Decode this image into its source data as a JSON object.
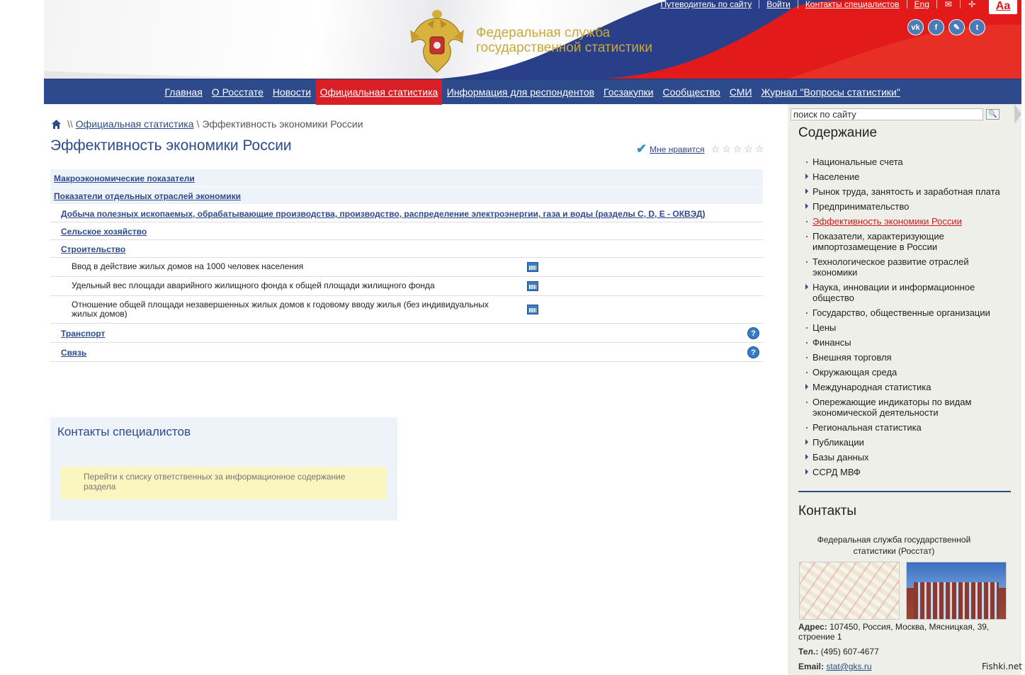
{
  "header": {
    "title_line1": "Федеральная служба",
    "title_line2": "государственной статистики",
    "toplinks": [
      "Путеводитель по сайту",
      "Войти",
      "Контакты специалистов",
      "Eng"
    ],
    "font_size_label": "Aa",
    "social": [
      "vk",
      "f",
      "✎",
      "t"
    ]
  },
  "nav": [
    "Главная",
    "О Росстате",
    "Новости",
    "Официальная статистика",
    "Информация для респондентов",
    "Госзакупки",
    "Сообщество",
    "СМИ",
    "Журнал \"Вопросы статистики\""
  ],
  "breadcrumb": {
    "sep1": "\\\\",
    "link": "Официальная статистика",
    "sep2": "\\",
    "current": "Эффективность экономики России"
  },
  "page_title": "Эффективность экономики России",
  "like_label": "Мне нравится",
  "table": {
    "sections": [
      "Макроэкономические показатели",
      "Показатели отдельных отраслей экономики"
    ],
    "subsections": [
      "Добыча полезных ископаемых, обрабатывающие производства, производство, распределение электроэнергии, газа и воды (разделы C, D, E - ОКВЭД)",
      "Сельское хозяйство",
      "Строительство"
    ],
    "items": [
      "Ввод в действие жилых домов на 1000 человек населения",
      "Удельный вес площади аварийного жилищного фонда к общей площади жилищного фонда",
      "Отношение общей площади незавершенных жилых домов к годовому вводу жилья (без индивидуальных жилых домов)"
    ],
    "bottom": [
      "Транспорт",
      "Связь"
    ],
    "help_label": "?"
  },
  "contacts_box": {
    "title": "Контакты специалистов",
    "note": "Перейти к списку ответственных за информационное содержание раздела"
  },
  "sidebar": {
    "search_placeholder": "поиск по сайту",
    "toc_title": "Содержание",
    "toc": [
      {
        "label": "Национальные счета",
        "mark": "dot"
      },
      {
        "label": "Население",
        "mark": "arrow"
      },
      {
        "label": "Рынок труда, занятость и заработная плата",
        "mark": "arrow"
      },
      {
        "label": "Предпринимательство",
        "mark": "arrow"
      },
      {
        "label": "Эффективность экономики России",
        "mark": "dot",
        "current": true
      },
      {
        "label": "Показатели, характеризующие импортозамещение в России",
        "mark": "dot"
      },
      {
        "label": "Технологическое развитие отраслей экономики",
        "mark": "dot"
      },
      {
        "label": "Наука, инновации и информационное общество",
        "mark": "arrow"
      },
      {
        "label": "Государство, общественные организации",
        "mark": "dot"
      },
      {
        "label": "Цены",
        "mark": "dot"
      },
      {
        "label": "Финансы",
        "mark": "dot"
      },
      {
        "label": "Внешняя торговля",
        "mark": "dot"
      },
      {
        "label": "Окружающая среда",
        "mark": "dot"
      },
      {
        "label": "Международная статистика",
        "mark": "arrow"
      },
      {
        "label": "Опережающие индикаторы по видам экономической деятельности",
        "mark": "dot"
      },
      {
        "label": "Региональная статистика",
        "mark": "dot"
      },
      {
        "label": "Публикации",
        "mark": "arrow"
      },
      {
        "label": "Базы данных",
        "mark": "arrow"
      },
      {
        "label": "ССРД МВФ",
        "mark": "arrow"
      }
    ],
    "contacts_title": "Контакты",
    "org_name": "Федеральная служба государственной статистики (Росстат)",
    "address_label": "Адрес:",
    "address": "107450, Россия, Москва, Мясницкая, 39, строение 1",
    "phone_label": "Тел.:",
    "phone": "(495) 607-4677",
    "email_label": "Email:",
    "email": "stat@gks.ru"
  },
  "watermark": "Fishki.net",
  "colors": {
    "brand_blue": "#2c4a8c",
    "accent_red": "#d81f26",
    "gold": "#c8a83b",
    "sidebar_bg": "#eeefe9"
  }
}
